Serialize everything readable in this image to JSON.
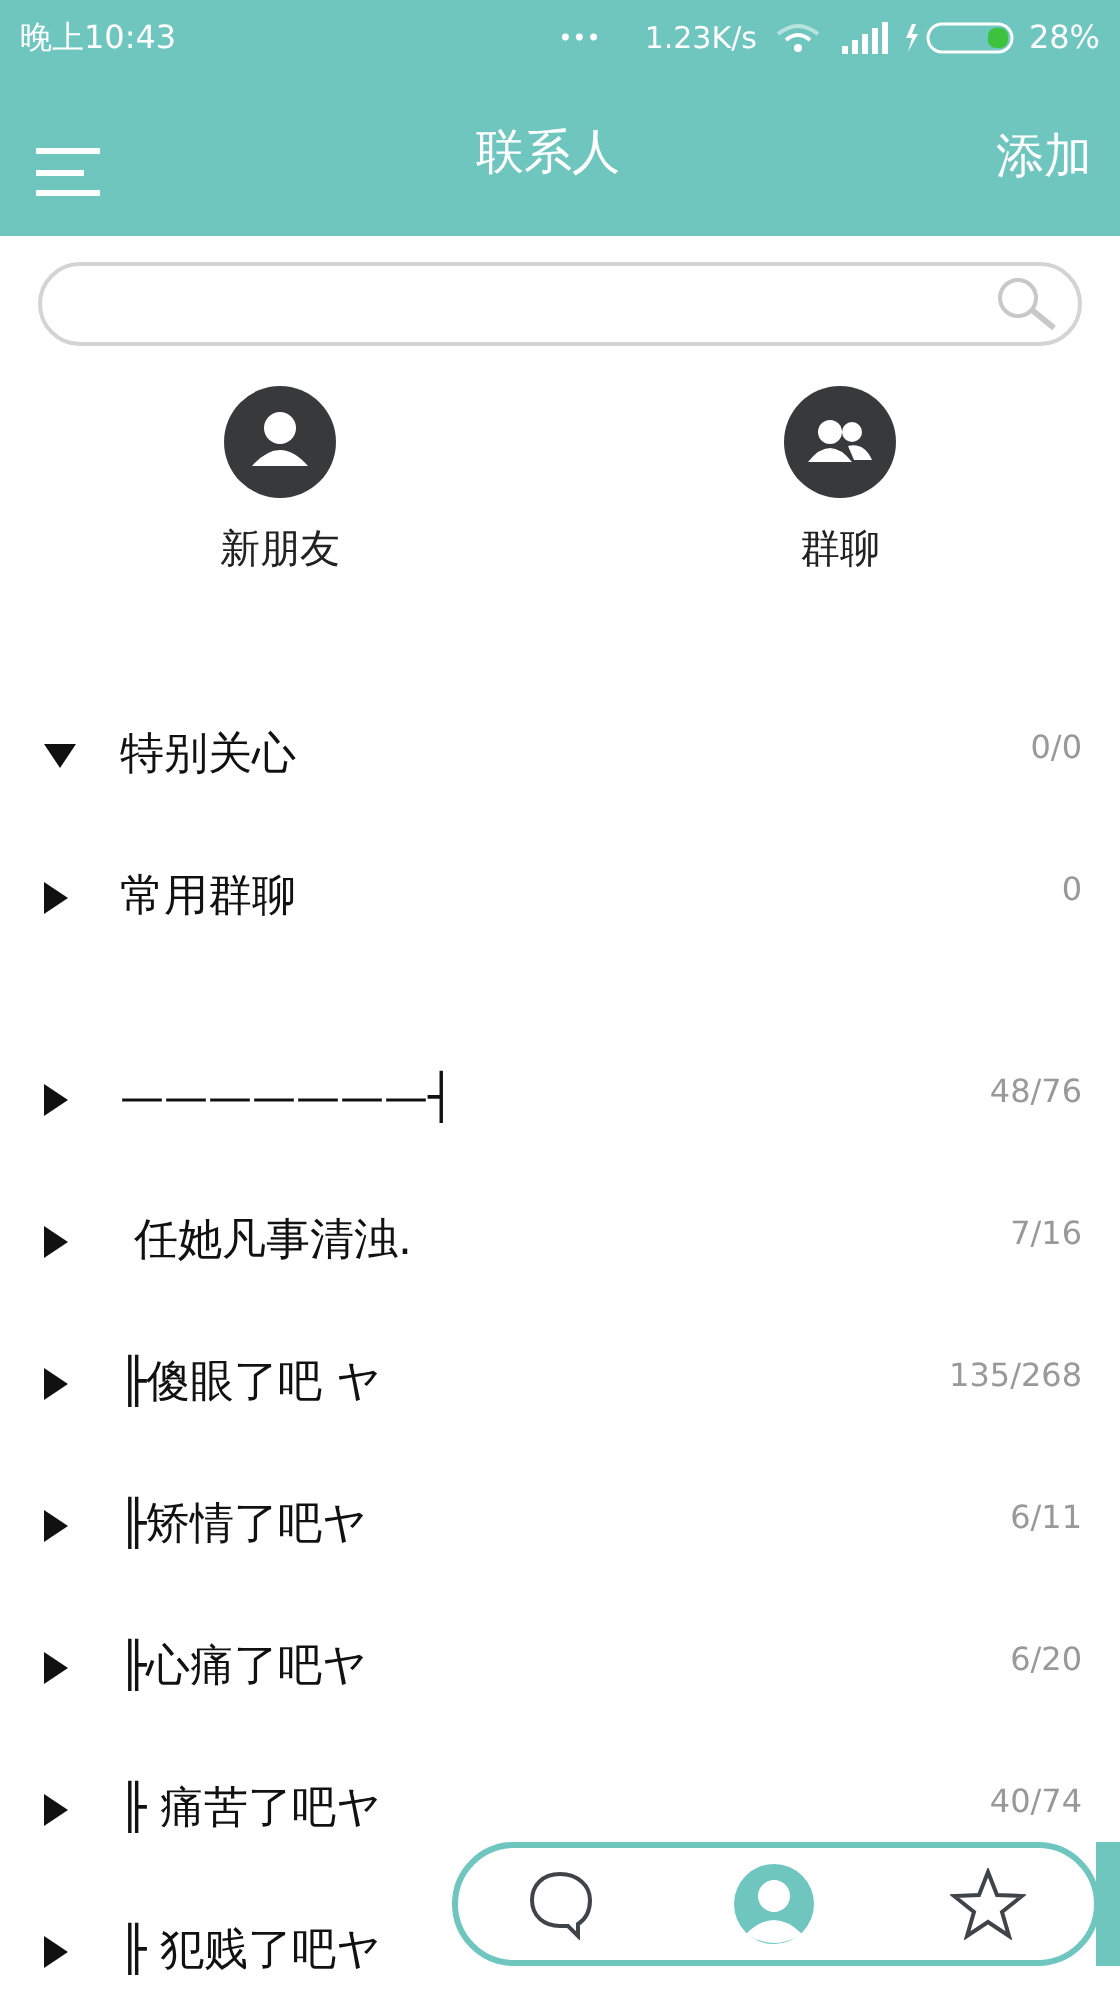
{
  "status_bar": {
    "time": "晚上10:43",
    "dots": "•••",
    "speed": "1.23K/s",
    "battery": "28%"
  },
  "header": {
    "title": "联系人",
    "action": "添加"
  },
  "shortcuts": [
    {
      "kind": "person",
      "label": "新朋友"
    },
    {
      "kind": "group",
      "label": "群聊"
    }
  ],
  "pinned_groups": [
    {
      "name": "特别关心",
      "count": "0/0",
      "expanded": true
    },
    {
      "name": "常用群聊",
      "count": "0",
      "expanded": false
    }
  ],
  "friend_groups": [
    {
      "name": "———————┤",
      "count": "48/76",
      "expanded": false
    },
    {
      "name": " 任她凡事清浊.",
      "count": "7/16",
      "expanded": false
    },
    {
      "name": "╟傻眼了吧 ヤ",
      "count": "135/268",
      "expanded": false
    },
    {
      "name": "╟矫情了吧ヤ",
      "count": "6/11",
      "expanded": false
    },
    {
      "name": "╟心痛了吧ヤ",
      "count": "6/20",
      "expanded": false
    },
    {
      "name": "╟ 痛苦了吧ヤ",
      "count": "40/74",
      "expanded": false
    },
    {
      "name": "╟ 犯贱了吧ヤ",
      "expanded": false
    }
  ],
  "tab_bar": [
    {
      "kind": "chat",
      "selected": false
    },
    {
      "kind": "contacts",
      "selected": true
    },
    {
      "kind": "favorites",
      "selected": false
    }
  ]
}
